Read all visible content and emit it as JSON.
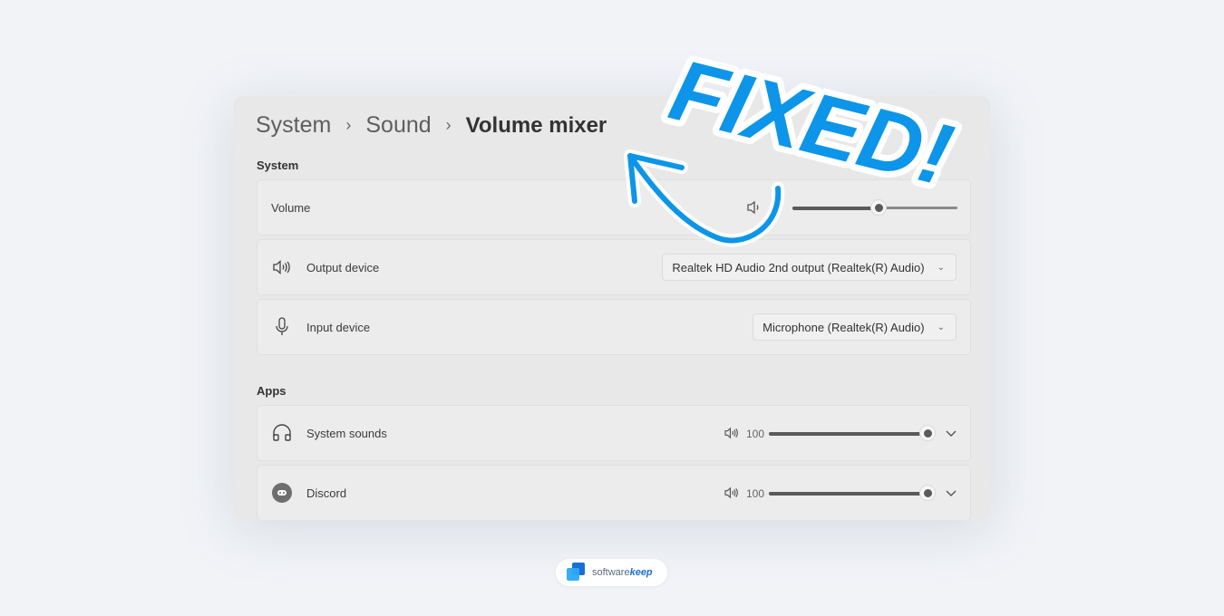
{
  "breadcrumb": {
    "items": [
      "System",
      "Sound"
    ],
    "current": "Volume mixer",
    "separator": "›"
  },
  "system_section": {
    "label": "System",
    "volume": {
      "label": "Volume",
      "value_percent": 52,
      "icon": "speaker-icon"
    },
    "output_device": {
      "label": "Output device",
      "selected": "Realtek HD Audio 2nd output (Realtek(R) Audio)",
      "icon": "speaker-icon"
    },
    "input_device": {
      "label": "Input device",
      "selected": "Microphone (Realtek(R) Audio)",
      "icon": "microphone-icon"
    }
  },
  "apps_section": {
    "label": "Apps",
    "apps": [
      {
        "name": "System sounds",
        "volume": "100",
        "value_percent": 100,
        "icon": "headphones-icon"
      },
      {
        "name": "Discord",
        "volume": "100",
        "value_percent": 100,
        "icon": "discord-icon"
      }
    ]
  },
  "overlay": {
    "text": "FIXED!",
    "color": "#0c95e9"
  },
  "branding": {
    "prefix": "software",
    "suffix": "keep"
  },
  "colors": {
    "accent": "#0c95e9",
    "brand_dark": "#1a6fd6",
    "brand_light": "#2aa8f5"
  }
}
